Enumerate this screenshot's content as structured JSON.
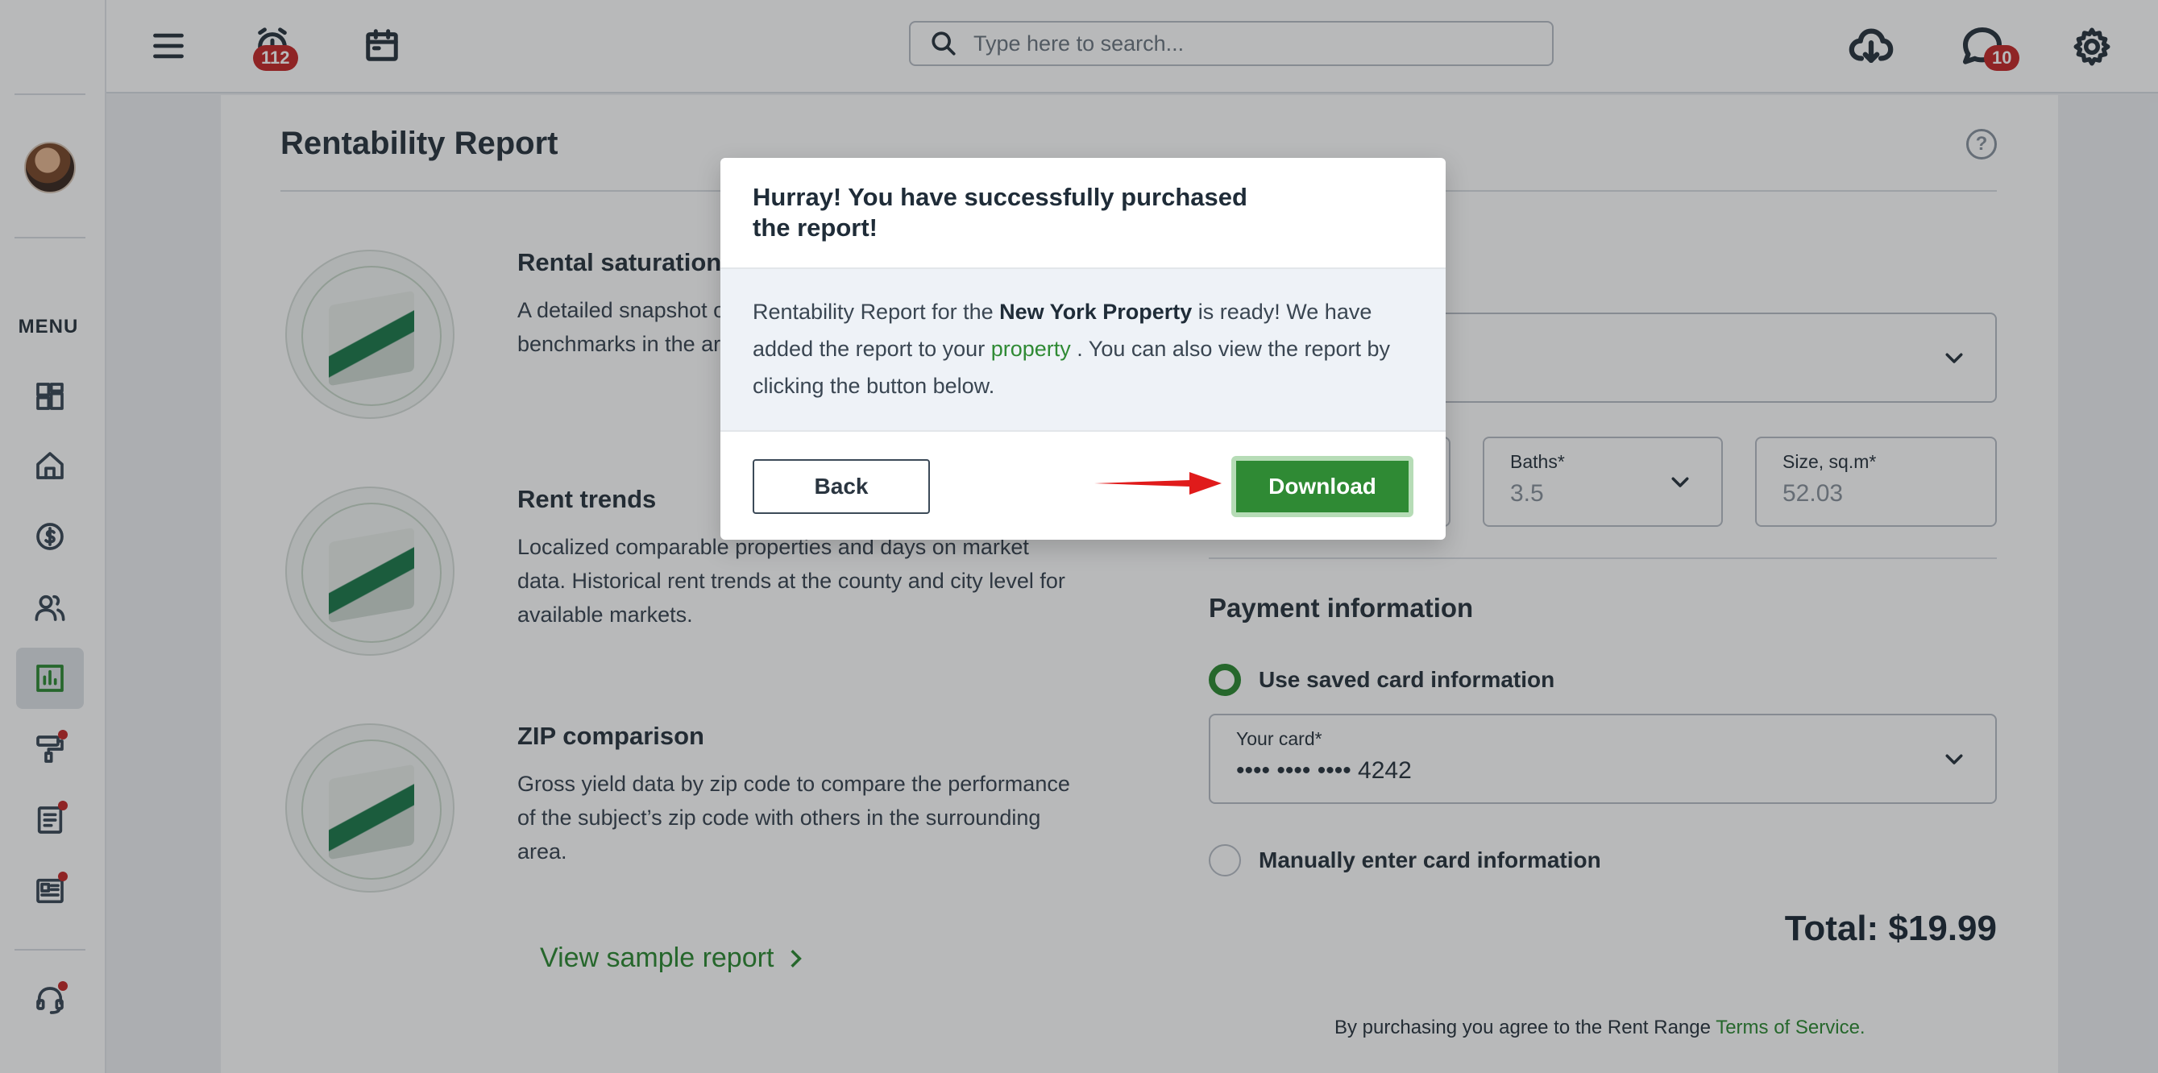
{
  "topbar": {
    "alarm_badge": "112",
    "chat_badge": "10",
    "search_placeholder": "Type here to search..."
  },
  "sidebar": {
    "menu_label": "MENU"
  },
  "page": {
    "title": "Rentability Report",
    "help_glyph": "?"
  },
  "features": [
    {
      "title": "Rental saturation",
      "desc": "A detailed snapshot of the specific vacancy rates and benchmarks in the area."
    },
    {
      "title": "Rent trends",
      "desc": "Localized comparable properties and days on market data. Historical rent trends at the county and city level for available markets."
    },
    {
      "title": "ZIP comparison",
      "desc": "Gross yield data by zip code to compare the performance of the subject’s zip code with others in the surrounding area."
    }
  ],
  "sample_link": "View sample report",
  "property": {
    "section_title_fragment": "on",
    "baths_label": "Baths*",
    "baths_value": "3.5",
    "size_label": "Size, sq.m*",
    "size_value": "52.03"
  },
  "payment": {
    "title": "Payment information",
    "saved_option": "Use saved card information",
    "card_label": "Your card*",
    "card_value": "•••• •••• •••• 4242",
    "manual_option": "Manually enter card information",
    "total": "Total: $19.99",
    "terms_prefix": "By purchasing you agree to the Rent Range",
    "terms_link": "Terms of Service."
  },
  "modal": {
    "title": "Hurray! You have successfully purchased the report!",
    "body_1": "Rentability Report for the ",
    "body_bold": "New York Property",
    "body_2": " is ready! We have added the report to your ",
    "body_link": "property",
    "body_3": " . You can also view the report by clicking the button below.",
    "back_label": "Back",
    "download_label": "Download"
  },
  "colors": {
    "accent_green": "#2f8a34",
    "badge_red": "#c42a2a",
    "arrow_red": "#e01b1b"
  }
}
